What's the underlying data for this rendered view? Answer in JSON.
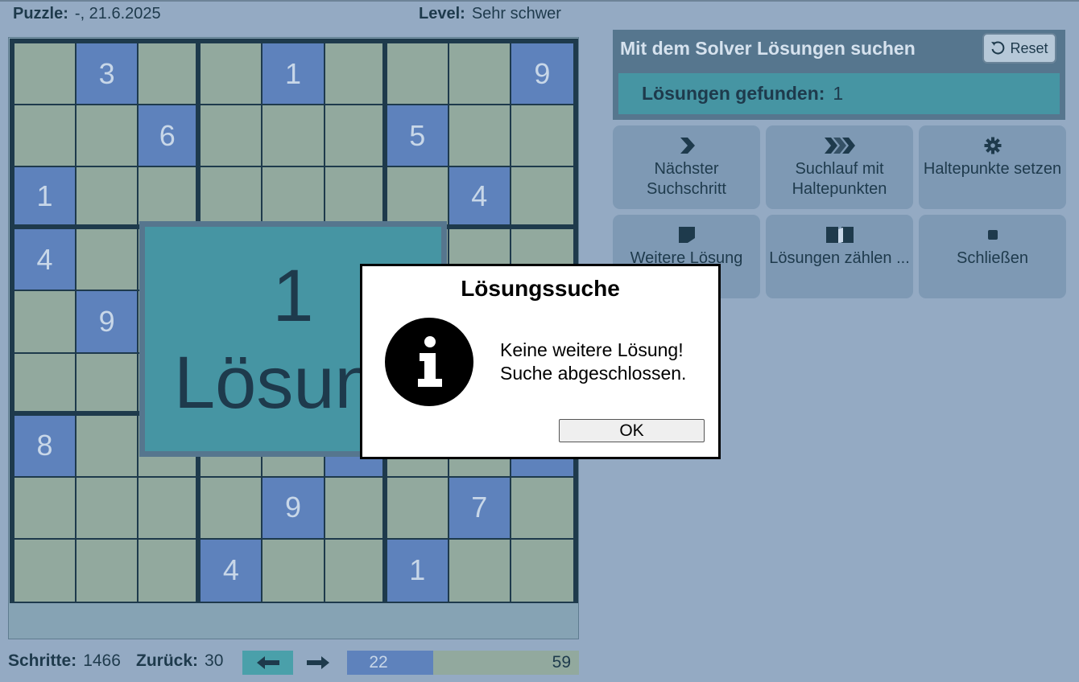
{
  "header": {
    "puzzle_label": "Puzzle:",
    "puzzle_value": "-,  21.6.2025",
    "level_label": "Level:",
    "level_value": "Sehr schwer"
  },
  "grid": [
    [
      "",
      "3",
      "",
      "",
      "1",
      "",
      "",
      "",
      "9"
    ],
    [
      "",
      "",
      "6",
      "",
      "",
      "",
      "5",
      "",
      ""
    ],
    [
      "1",
      "",
      "",
      "",
      "",
      "",
      "",
      "4",
      ""
    ],
    [
      "4",
      "",
      "",
      "",
      "",
      "",
      "",
      "",
      ""
    ],
    [
      "",
      "9",
      "",
      "",
      "",
      "",
      "",
      "",
      ""
    ],
    [
      "",
      "",
      "",
      "",
      "",
      "",
      "",
      "",
      ""
    ],
    [
      "8",
      "",
      "",
      "",
      "",
      "",
      "",
      "",
      ""
    ],
    [
      "",
      "",
      "",
      "",
      "9",
      "",
      "",
      "7",
      ""
    ],
    [
      "",
      "",
      "",
      "4",
      "",
      "",
      "1",
      "",
      ""
    ]
  ],
  "given_cells": [
    [
      0,
      1
    ],
    [
      0,
      4
    ],
    [
      0,
      8
    ],
    [
      1,
      2
    ],
    [
      1,
      6
    ],
    [
      2,
      0
    ],
    [
      2,
      7
    ],
    [
      3,
      0
    ],
    [
      4,
      1
    ],
    [
      6,
      0
    ],
    [
      6,
      5
    ],
    [
      6,
      8
    ],
    [
      7,
      4
    ],
    [
      7,
      7
    ],
    [
      8,
      3
    ],
    [
      8,
      6
    ]
  ],
  "overlay": {
    "count": "1",
    "label": "Lösun"
  },
  "footer": {
    "steps_label": "Schritte:",
    "steps_value": "1466",
    "back_label": "Zurück:",
    "back_value": "30",
    "undo_icon": "arrow-left-icon",
    "redo_icon": "arrow-right-icon",
    "progress_current": "22",
    "progress_total": "59",
    "progress_fraction": 0.373
  },
  "solver": {
    "title": "Mit dem Solver Lösungen suchen",
    "reset_label": "Reset",
    "found_label": "Lösungen gefunden:",
    "found_value": "1",
    "buttons": [
      {
        "label": "Nächster Suchschritt",
        "icon": "chevron-right-icon"
      },
      {
        "label": "Suchlauf mit Haltepunkten",
        "icon": "double-chevron-right-icon"
      },
      {
        "label": "Haltepunkte setzen",
        "icon": "gear-icon"
      },
      {
        "label": "Weitere Lösung",
        "icon": "page-icon"
      },
      {
        "label": "Lösungen zählen ...",
        "icon": "open-book-icon"
      },
      {
        "label": "Schließen",
        "icon": "stop-icon"
      }
    ]
  },
  "dialog": {
    "title": "Lösungssuche",
    "line1": "Keine weitere Lösung!",
    "line2": "Suche abgeschlossen.",
    "ok_label": "OK",
    "icon": "info-icon"
  },
  "colors": {
    "background": "#94aac3",
    "given_cell": "#5e82bc",
    "empty_cell": "#92a99e",
    "accent_teal": "#4695a3",
    "dark": "#1e3a4c"
  }
}
